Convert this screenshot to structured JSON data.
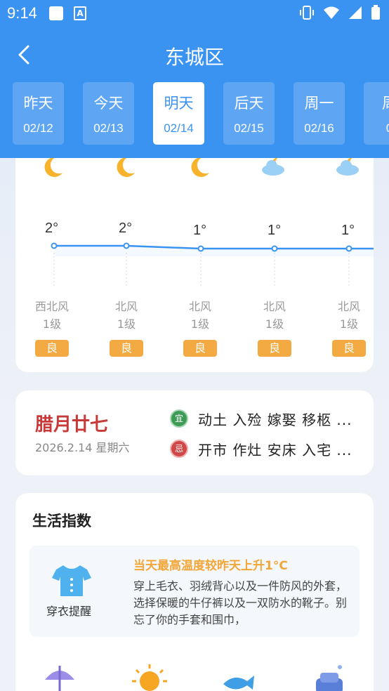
{
  "status": {
    "time": "9:14"
  },
  "nav": {
    "title": "东城区"
  },
  "days": [
    {
      "name": "昨天",
      "date": "02/12"
    },
    {
      "name": "今天",
      "date": "02/13"
    },
    {
      "name": "明天",
      "date": "02/14"
    },
    {
      "name": "后天",
      "date": "02/15"
    },
    {
      "name": "周一",
      "date": "02/16"
    },
    {
      "name": "周",
      "date": "0"
    }
  ],
  "active_day_index": 2,
  "forecast": {
    "temps": [
      "2°",
      "2°",
      "1°",
      "1°",
      "1°"
    ],
    "temp_values": [
      2,
      2,
      1,
      1,
      1
    ],
    "icons": [
      "moon-icon",
      "moon-icon",
      "moon-icon",
      "cloudy-moon-icon",
      "cloudy-moon-icon"
    ],
    "wind_dir": [
      "西北风",
      "北风",
      "北风",
      "北风",
      "北风"
    ],
    "wind_level": [
      "1级",
      "1级",
      "1级",
      "1级",
      "1级"
    ],
    "aqi": [
      "良",
      "良",
      "良",
      "良",
      "良"
    ]
  },
  "almanac": {
    "lunar": "腊月廿七",
    "solar": "2026.2.14 星期六",
    "yi_badge": "宜",
    "ji_badge": "忌",
    "yi": "动土  入殓  嫁娶  移柩  ...",
    "ji": "开市  作灶  安床  入宅  ..."
  },
  "life": {
    "title": "生活指数",
    "item_label": "穿衣提醒",
    "headline": "当天最高温度较昨天上升1°C",
    "desc": "穿上毛衣、羽绒背心以及一件防风的外套，选择保暖的牛仔裤以及一双防水的靴子。别忘了你的手套和围巾，",
    "grid_icons": [
      "umbrella-icon",
      "sun-icon",
      "fish-icon",
      "car-icon"
    ]
  },
  "colors": {
    "header": "#3b93f1",
    "aqi": "#f3aa43",
    "lunar": "#c83a3a",
    "yi": "#3e9b56",
    "ji": "#d04848",
    "headline": "#f3a638"
  }
}
